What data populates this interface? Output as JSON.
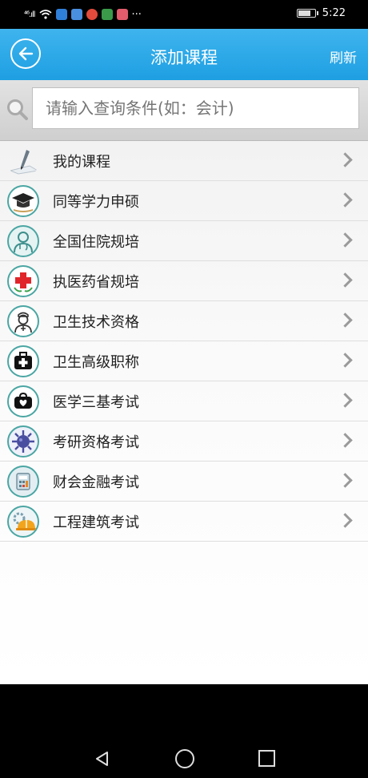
{
  "status_bar": {
    "signal": "⁴⁶.ıll",
    "time": "5:22",
    "more": "···"
  },
  "header": {
    "title": "添加课程",
    "refresh_label": "刷新"
  },
  "search": {
    "placeholder": "请输入查询条件(如：会计)"
  },
  "courses": [
    {
      "label": "我的课程",
      "icon": "pen-paper-icon"
    },
    {
      "label": "同等学力申硕",
      "icon": "graduation-cap-icon"
    },
    {
      "label": "全国住院规培",
      "icon": "doctor-icon"
    },
    {
      "label": "执医药省规培",
      "icon": "red-cross-icon"
    },
    {
      "label": "卫生技术资格",
      "icon": "nurse-icon"
    },
    {
      "label": "卫生高级职称",
      "icon": "medical-kit-icon"
    },
    {
      "label": "医学三基考试",
      "icon": "first-aid-bag-icon"
    },
    {
      "label": "考研资格考试",
      "icon": "virus-icon"
    },
    {
      "label": "财会金融考试",
      "icon": "calculator-icon"
    },
    {
      "label": "工程建筑考试",
      "icon": "helmet-gear-icon"
    }
  ],
  "colors": {
    "header": "#1e9fe2",
    "icon_ring": "#4aa6a3"
  }
}
